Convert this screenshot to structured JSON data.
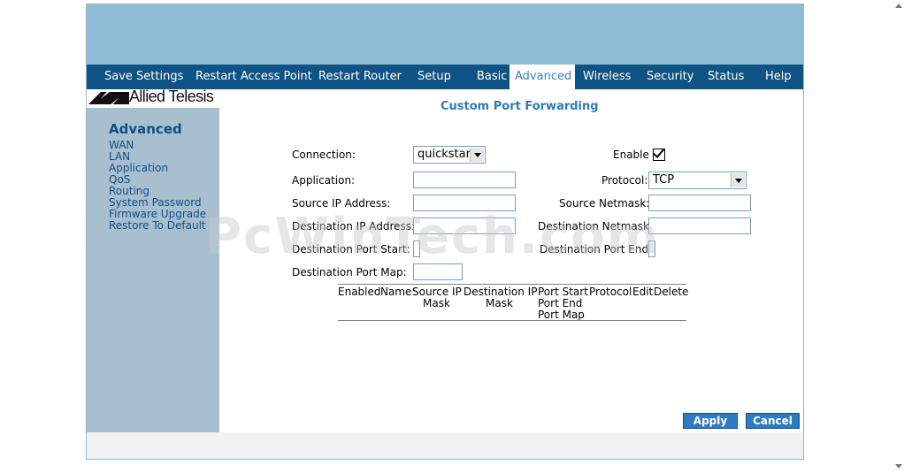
{
  "nav": [
    {
      "label": "Save Settings"
    },
    {
      "label": "Restart Access Point"
    },
    {
      "label": "Restart Router"
    },
    {
      "label": "Setup"
    },
    {
      "label": "Basic"
    },
    {
      "label": "Advanced"
    },
    {
      "label": "Wireless"
    },
    {
      "label": "Security"
    },
    {
      "label": "Status"
    },
    {
      "label": "Help"
    }
  ],
  "logo": {
    "text": "Allied Telesis"
  },
  "sidebar": {
    "heading": "Advanced",
    "items": [
      {
        "label": "WAN"
      },
      {
        "label": "LAN"
      },
      {
        "label": "Application"
      },
      {
        "label": "QoS"
      },
      {
        "label": "Routing"
      },
      {
        "label": "System Password"
      },
      {
        "label": "Firmware Upgrade"
      },
      {
        "label": "Restore To Default"
      }
    ]
  },
  "main": {
    "title": "Custom Port Forwarding",
    "form": {
      "connection_label": "Connection:",
      "connection_value": "quickstart",
      "enable_label": "Enable",
      "enable_checked": true,
      "application_label": "Application:",
      "application_value": "",
      "protocol_label": "Protocol:",
      "protocol_value": "TCP",
      "source_ip_label": "Source IP Address:",
      "source_ip_value": "",
      "source_netmask_label": "Source Netmask:",
      "source_netmask_value": "",
      "dest_ip_label": "Destination IP Address:",
      "dest_ip_value": "",
      "dest_netmask_label": "Destination Netmask:",
      "dest_port_start_label": "Destination Port Start:",
      "dest_port_end_label": "Destination Port End:",
      "dest_port_map_label": "Destination Port Map:"
    },
    "table_headers": {
      "enabled": "Enabled",
      "name": "Name",
      "source_ip": "Source IP",
      "source_mask": "Mask",
      "dest_ip": "Destination IP",
      "dest_mask": "Mask",
      "port_start": "Port Start",
      "port_end": "Port End",
      "port_map": "Port Map",
      "protocol": "Protocol",
      "edit": "Edit",
      "delete": "Delete"
    }
  },
  "buttons": {
    "apply": "Apply",
    "cancel": "Cancel"
  },
  "watermark": "PcWinTech.com",
  "colors": {
    "nav_bg": "#0e5384",
    "banner": "#8fbcd4",
    "sidebar": "#a8bfcf",
    "button": "#2f7ac4",
    "title": "#2c7bb6"
  }
}
